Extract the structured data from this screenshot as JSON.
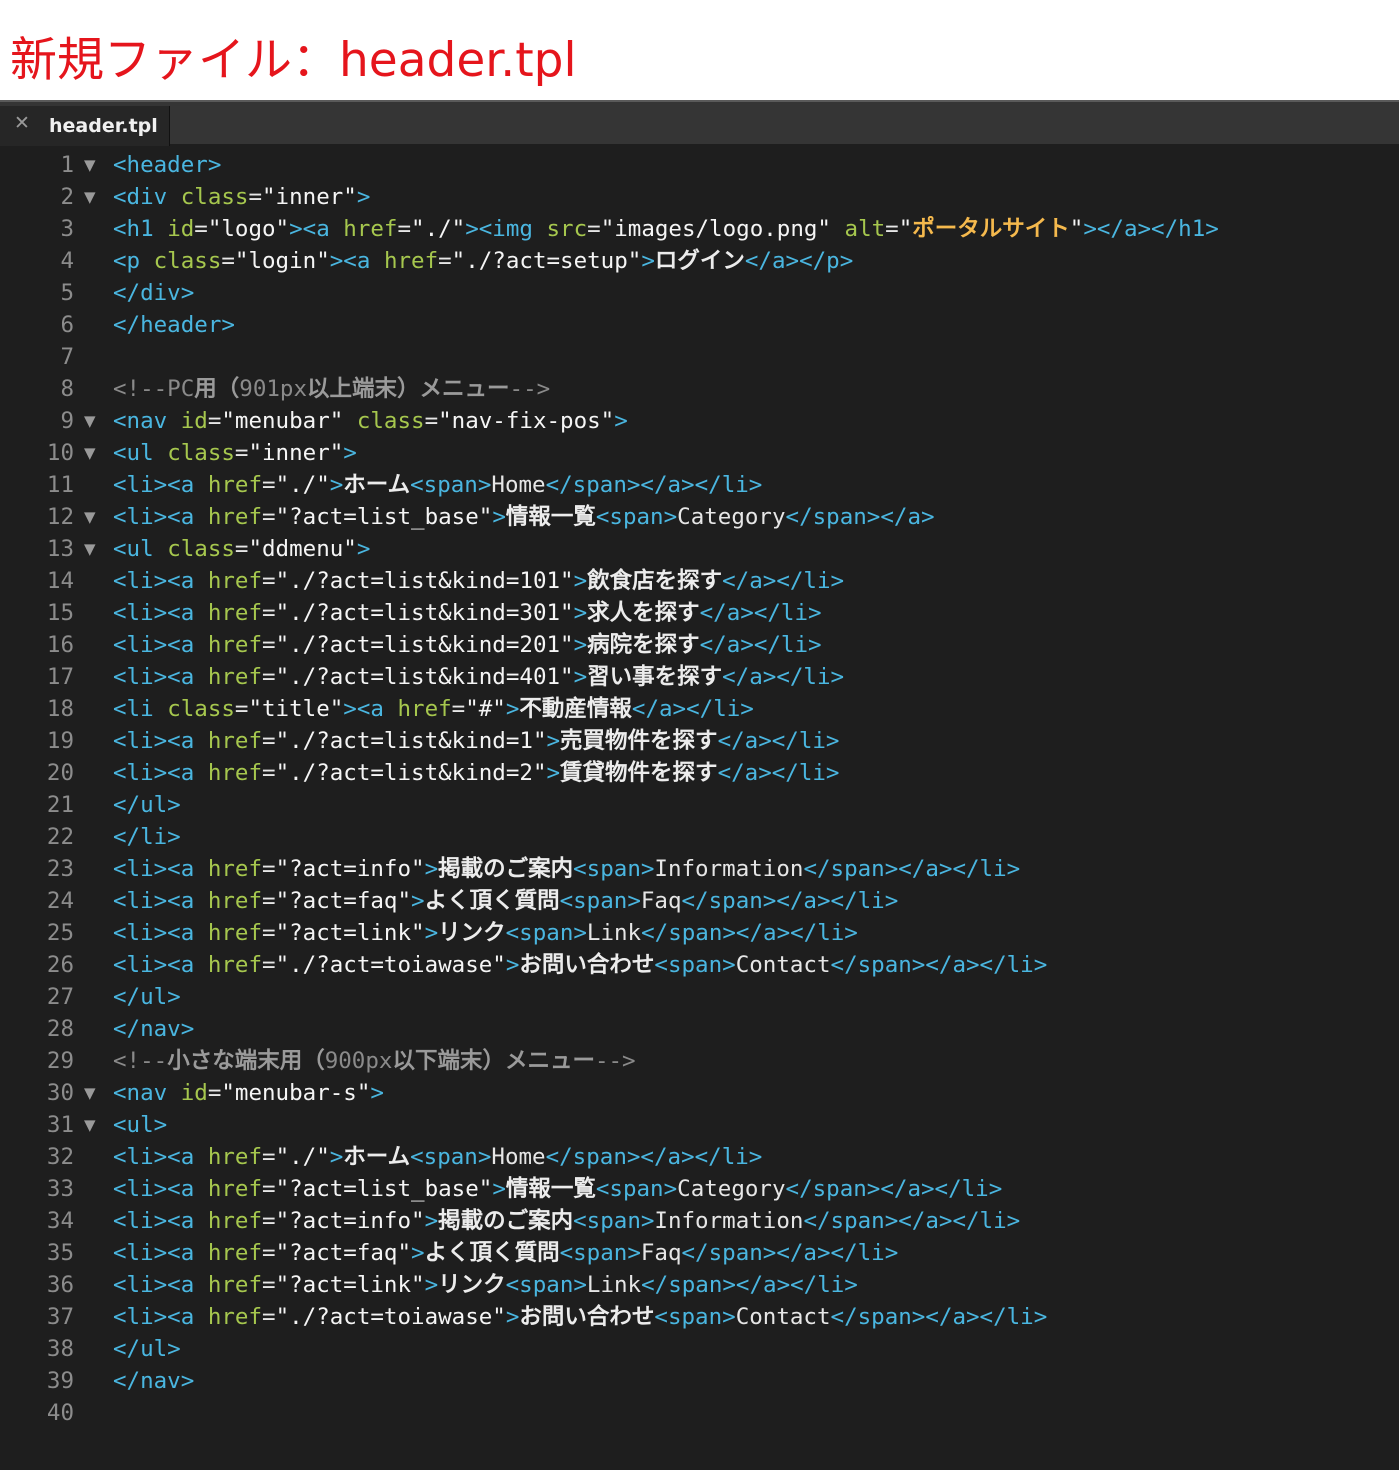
{
  "caption": "新規ファイル：header.tpl",
  "tab": {
    "close_icon": "close-icon",
    "label": "header.tpl"
  },
  "colors": {
    "caption": "#e5151c",
    "editor_bg": "#1e1e1e",
    "tag": "#4ab6e0",
    "attribute": "#a6c74e",
    "string": "#f5f5f5",
    "alt_text": "#f5b94d",
    "comment": "#8a8a8a",
    "line_number": "#8c8c8c"
  },
  "lines": [
    {
      "n": "1",
      "fold": true,
      "segs": [
        [
          "t",
          "<header>"
        ]
      ]
    },
    {
      "n": "2",
      "fold": true,
      "segs": [
        [
          "t",
          "<div "
        ],
        [
          "a",
          "class"
        ],
        [
          "e",
          "="
        ],
        [
          "s",
          "\"inner\""
        ],
        [
          "t",
          ">"
        ]
      ]
    },
    {
      "n": "3",
      "fold": false,
      "segs": [
        [
          "t",
          "<h1 "
        ],
        [
          "a",
          "id"
        ],
        [
          "e",
          "="
        ],
        [
          "s",
          "\"logo\""
        ],
        [
          "t",
          "><a "
        ],
        [
          "a",
          "href"
        ],
        [
          "e",
          "="
        ],
        [
          "s",
          "\"./\""
        ],
        [
          "t",
          "><img "
        ],
        [
          "a",
          "src"
        ],
        [
          "e",
          "="
        ],
        [
          "s",
          "\"images/logo.png\" "
        ],
        [
          "a",
          "alt"
        ],
        [
          "e",
          "="
        ],
        [
          "s",
          "\""
        ],
        [
          "k",
          "ポータルサイト"
        ],
        [
          "s",
          "\""
        ],
        [
          "t",
          "></a></h1>"
        ]
      ]
    },
    {
      "n": "4",
      "fold": false,
      "segs": [
        [
          "t",
          "<p "
        ],
        [
          "a",
          "class"
        ],
        [
          "e",
          "="
        ],
        [
          "s",
          "\"login\""
        ],
        [
          "t",
          "><a "
        ],
        [
          "a",
          "href"
        ],
        [
          "e",
          "="
        ],
        [
          "s",
          "\"./?act=setup\""
        ],
        [
          "t",
          ">"
        ],
        [
          "j",
          "ログイン"
        ],
        [
          "t",
          "</a></p>"
        ]
      ]
    },
    {
      "n": "5",
      "fold": false,
      "segs": [
        [
          "t",
          "</div>"
        ]
      ]
    },
    {
      "n": "6",
      "fold": false,
      "segs": [
        [
          "t",
          "</header>"
        ]
      ]
    },
    {
      "n": "7",
      "fold": false,
      "segs": []
    },
    {
      "n": "8",
      "fold": false,
      "segs": [
        [
          "c",
          "<!--PC"
        ],
        [
          "cj",
          "用（"
        ],
        [
          "c",
          "901px"
        ],
        [
          "cj",
          "以上端末）メニュー"
        ],
        [
          "c",
          "-->"
        ]
      ]
    },
    {
      "n": "9",
      "fold": true,
      "segs": [
        [
          "t",
          "<nav "
        ],
        [
          "a",
          "id"
        ],
        [
          "e",
          "="
        ],
        [
          "s",
          "\"menubar\" "
        ],
        [
          "a",
          "class"
        ],
        [
          "e",
          "="
        ],
        [
          "s",
          "\"nav-fix-pos\""
        ],
        [
          "t",
          ">"
        ]
      ]
    },
    {
      "n": "10",
      "fold": true,
      "segs": [
        [
          "t",
          "<ul "
        ],
        [
          "a",
          "class"
        ],
        [
          "e",
          "="
        ],
        [
          "s",
          "\"inner\""
        ],
        [
          "t",
          ">"
        ]
      ]
    },
    {
      "n": "11",
      "fold": false,
      "segs": [
        [
          "t",
          "<li><a "
        ],
        [
          "a",
          "href"
        ],
        [
          "e",
          "="
        ],
        [
          "s",
          "\"./\""
        ],
        [
          "t",
          ">"
        ],
        [
          "j",
          "ホーム"
        ],
        [
          "t",
          "<span>"
        ],
        [
          "x",
          "Home"
        ],
        [
          "t",
          "</span></a></li>"
        ]
      ]
    },
    {
      "n": "12",
      "fold": true,
      "segs": [
        [
          "t",
          "<li><a "
        ],
        [
          "a",
          "href"
        ],
        [
          "e",
          "="
        ],
        [
          "s",
          "\"?act=list_base\""
        ],
        [
          "t",
          ">"
        ],
        [
          "j",
          "情報一覧"
        ],
        [
          "t",
          "<span>"
        ],
        [
          "x",
          "Category"
        ],
        [
          "t",
          "</span></a>"
        ]
      ]
    },
    {
      "n": "13",
      "fold": true,
      "segs": [
        [
          "t",
          "<ul "
        ],
        [
          "a",
          "class"
        ],
        [
          "e",
          "="
        ],
        [
          "s",
          "\"ddmenu\""
        ],
        [
          "t",
          ">"
        ]
      ]
    },
    {
      "n": "14",
      "fold": false,
      "segs": [
        [
          "t",
          "<li><a "
        ],
        [
          "a",
          "href"
        ],
        [
          "e",
          "="
        ],
        [
          "s",
          "\"./?act=list&kind=101\""
        ],
        [
          "t",
          ">"
        ],
        [
          "j",
          "飲食店を探す"
        ],
        [
          "t",
          "</a></li>"
        ]
      ]
    },
    {
      "n": "15",
      "fold": false,
      "segs": [
        [
          "t",
          "<li><a "
        ],
        [
          "a",
          "href"
        ],
        [
          "e",
          "="
        ],
        [
          "s",
          "\"./?act=list&kind=301\""
        ],
        [
          "t",
          ">"
        ],
        [
          "j",
          "求人を探す"
        ],
        [
          "t",
          "</a></li>"
        ]
      ]
    },
    {
      "n": "16",
      "fold": false,
      "segs": [
        [
          "t",
          "<li><a "
        ],
        [
          "a",
          "href"
        ],
        [
          "e",
          "="
        ],
        [
          "s",
          "\"./?act=list&kind=201\""
        ],
        [
          "t",
          ">"
        ],
        [
          "j",
          "病院を探す"
        ],
        [
          "t",
          "</a></li>"
        ]
      ]
    },
    {
      "n": "17",
      "fold": false,
      "segs": [
        [
          "t",
          "<li><a "
        ],
        [
          "a",
          "href"
        ],
        [
          "e",
          "="
        ],
        [
          "s",
          "\"./?act=list&kind=401\""
        ],
        [
          "t",
          ">"
        ],
        [
          "j",
          "習い事を探す"
        ],
        [
          "t",
          "</a></li>"
        ]
      ]
    },
    {
      "n": "18",
      "fold": false,
      "segs": [
        [
          "t",
          "<li "
        ],
        [
          "a",
          "class"
        ],
        [
          "e",
          "="
        ],
        [
          "s",
          "\"title\""
        ],
        [
          "t",
          "><a "
        ],
        [
          "a",
          "href"
        ],
        [
          "e",
          "="
        ],
        [
          "s",
          "\"#\""
        ],
        [
          "t",
          ">"
        ],
        [
          "j",
          "不動産情報"
        ],
        [
          "t",
          "</a></li>"
        ]
      ]
    },
    {
      "n": "19",
      "fold": false,
      "segs": [
        [
          "t",
          "<li><a "
        ],
        [
          "a",
          "href"
        ],
        [
          "e",
          "="
        ],
        [
          "s",
          "\"./?act=list&kind=1\""
        ],
        [
          "t",
          ">"
        ],
        [
          "j",
          "売買物件を探す"
        ],
        [
          "t",
          "</a></li>"
        ]
      ]
    },
    {
      "n": "20",
      "fold": false,
      "segs": [
        [
          "t",
          "<li><a "
        ],
        [
          "a",
          "href"
        ],
        [
          "e",
          "="
        ],
        [
          "s",
          "\"./?act=list&kind=2\""
        ],
        [
          "t",
          ">"
        ],
        [
          "j",
          "賃貸物件を探す"
        ],
        [
          "t",
          "</a></li>"
        ]
      ]
    },
    {
      "n": "21",
      "fold": false,
      "segs": [
        [
          "t",
          "</ul>"
        ]
      ]
    },
    {
      "n": "22",
      "fold": false,
      "segs": [
        [
          "t",
          "</li>"
        ]
      ]
    },
    {
      "n": "23",
      "fold": false,
      "segs": [
        [
          "t",
          "<li><a "
        ],
        [
          "a",
          "href"
        ],
        [
          "e",
          "="
        ],
        [
          "s",
          "\"?act=info\""
        ],
        [
          "t",
          ">"
        ],
        [
          "j",
          "掲載のご案内"
        ],
        [
          "t",
          "<span>"
        ],
        [
          "x",
          "Information"
        ],
        [
          "t",
          "</span></a></li>"
        ]
      ]
    },
    {
      "n": "24",
      "fold": false,
      "segs": [
        [
          "t",
          "<li><a "
        ],
        [
          "a",
          "href"
        ],
        [
          "e",
          "="
        ],
        [
          "s",
          "\"?act=faq\""
        ],
        [
          "t",
          ">"
        ],
        [
          "j",
          "よく頂く質問"
        ],
        [
          "t",
          "<span>"
        ],
        [
          "x",
          "Faq"
        ],
        [
          "t",
          "</span></a></li>"
        ]
      ]
    },
    {
      "n": "25",
      "fold": false,
      "segs": [
        [
          "t",
          "<li><a "
        ],
        [
          "a",
          "href"
        ],
        [
          "e",
          "="
        ],
        [
          "s",
          "\"?act=link\""
        ],
        [
          "t",
          ">"
        ],
        [
          "j",
          "リンク"
        ],
        [
          "t",
          "<span>"
        ],
        [
          "x",
          "Link"
        ],
        [
          "t",
          "</span></a></li>"
        ]
      ]
    },
    {
      "n": "26",
      "fold": false,
      "segs": [
        [
          "t",
          "<li><a "
        ],
        [
          "a",
          "href"
        ],
        [
          "e",
          "="
        ],
        [
          "s",
          "\"./?act=toiawase\""
        ],
        [
          "t",
          ">"
        ],
        [
          "j",
          "お問い合わせ"
        ],
        [
          "t",
          "<span>"
        ],
        [
          "x",
          "Contact"
        ],
        [
          "t",
          "</span></a></li>"
        ]
      ]
    },
    {
      "n": "27",
      "fold": false,
      "segs": [
        [
          "t",
          "</ul>"
        ]
      ]
    },
    {
      "n": "28",
      "fold": false,
      "segs": [
        [
          "t",
          "</nav>"
        ]
      ]
    },
    {
      "n": "29",
      "fold": false,
      "segs": [
        [
          "c",
          "<!--"
        ],
        [
          "cj",
          "小さな端末用（"
        ],
        [
          "c",
          "900px"
        ],
        [
          "cj",
          "以下端末）メニュー"
        ],
        [
          "c",
          "-->"
        ]
      ]
    },
    {
      "n": "30",
      "fold": true,
      "segs": [
        [
          "t",
          "<nav "
        ],
        [
          "a",
          "id"
        ],
        [
          "e",
          "="
        ],
        [
          "s",
          "\"menubar-s\""
        ],
        [
          "t",
          ">"
        ]
      ]
    },
    {
      "n": "31",
      "fold": true,
      "segs": [
        [
          "t",
          "<ul>"
        ]
      ]
    },
    {
      "n": "32",
      "fold": false,
      "segs": [
        [
          "t",
          "<li><a "
        ],
        [
          "a",
          "href"
        ],
        [
          "e",
          "="
        ],
        [
          "s",
          "\"./\""
        ],
        [
          "t",
          ">"
        ],
        [
          "j",
          "ホーム"
        ],
        [
          "t",
          "<span>"
        ],
        [
          "x",
          "Home"
        ],
        [
          "t",
          "</span></a></li>"
        ]
      ]
    },
    {
      "n": "33",
      "fold": false,
      "segs": [
        [
          "t",
          "<li><a "
        ],
        [
          "a",
          "href"
        ],
        [
          "e",
          "="
        ],
        [
          "s",
          "\"?act=list_base\""
        ],
        [
          "t",
          ">"
        ],
        [
          "j",
          "情報一覧"
        ],
        [
          "t",
          "<span>"
        ],
        [
          "x",
          "Category"
        ],
        [
          "t",
          "</span></a></li>"
        ]
      ]
    },
    {
      "n": "34",
      "fold": false,
      "segs": [
        [
          "t",
          "<li><a "
        ],
        [
          "a",
          "href"
        ],
        [
          "e",
          "="
        ],
        [
          "s",
          "\"?act=info\""
        ],
        [
          "t",
          ">"
        ],
        [
          "j",
          "掲載のご案内"
        ],
        [
          "t",
          "<span>"
        ],
        [
          "x",
          "Information"
        ],
        [
          "t",
          "</span></a></li>"
        ]
      ]
    },
    {
      "n": "35",
      "fold": false,
      "segs": [
        [
          "t",
          "<li><a "
        ],
        [
          "a",
          "href"
        ],
        [
          "e",
          "="
        ],
        [
          "s",
          "\"?act=faq\""
        ],
        [
          "t",
          ">"
        ],
        [
          "j",
          "よく頂く質問"
        ],
        [
          "t",
          "<span>"
        ],
        [
          "x",
          "Faq"
        ],
        [
          "t",
          "</span></a></li>"
        ]
      ]
    },
    {
      "n": "36",
      "fold": false,
      "segs": [
        [
          "t",
          "<li><a "
        ],
        [
          "a",
          "href"
        ],
        [
          "e",
          "="
        ],
        [
          "s",
          "\"?act=link\""
        ],
        [
          "t",
          ">"
        ],
        [
          "j",
          "リンク"
        ],
        [
          "t",
          "<span>"
        ],
        [
          "x",
          "Link"
        ],
        [
          "t",
          "</span></a></li>"
        ]
      ]
    },
    {
      "n": "37",
      "fold": false,
      "segs": [
        [
          "t",
          "<li><a "
        ],
        [
          "a",
          "href"
        ],
        [
          "e",
          "="
        ],
        [
          "s",
          "\"./?act=toiawase\""
        ],
        [
          "t",
          ">"
        ],
        [
          "j",
          "お問い合わせ"
        ],
        [
          "t",
          "<span>"
        ],
        [
          "x",
          "Contact"
        ],
        [
          "t",
          "</span></a></li>"
        ]
      ]
    },
    {
      "n": "38",
      "fold": false,
      "segs": [
        [
          "t",
          "</ul>"
        ]
      ]
    },
    {
      "n": "39",
      "fold": false,
      "segs": [
        [
          "t",
          "</nav>"
        ]
      ]
    },
    {
      "n": "40",
      "fold": false,
      "segs": []
    }
  ]
}
